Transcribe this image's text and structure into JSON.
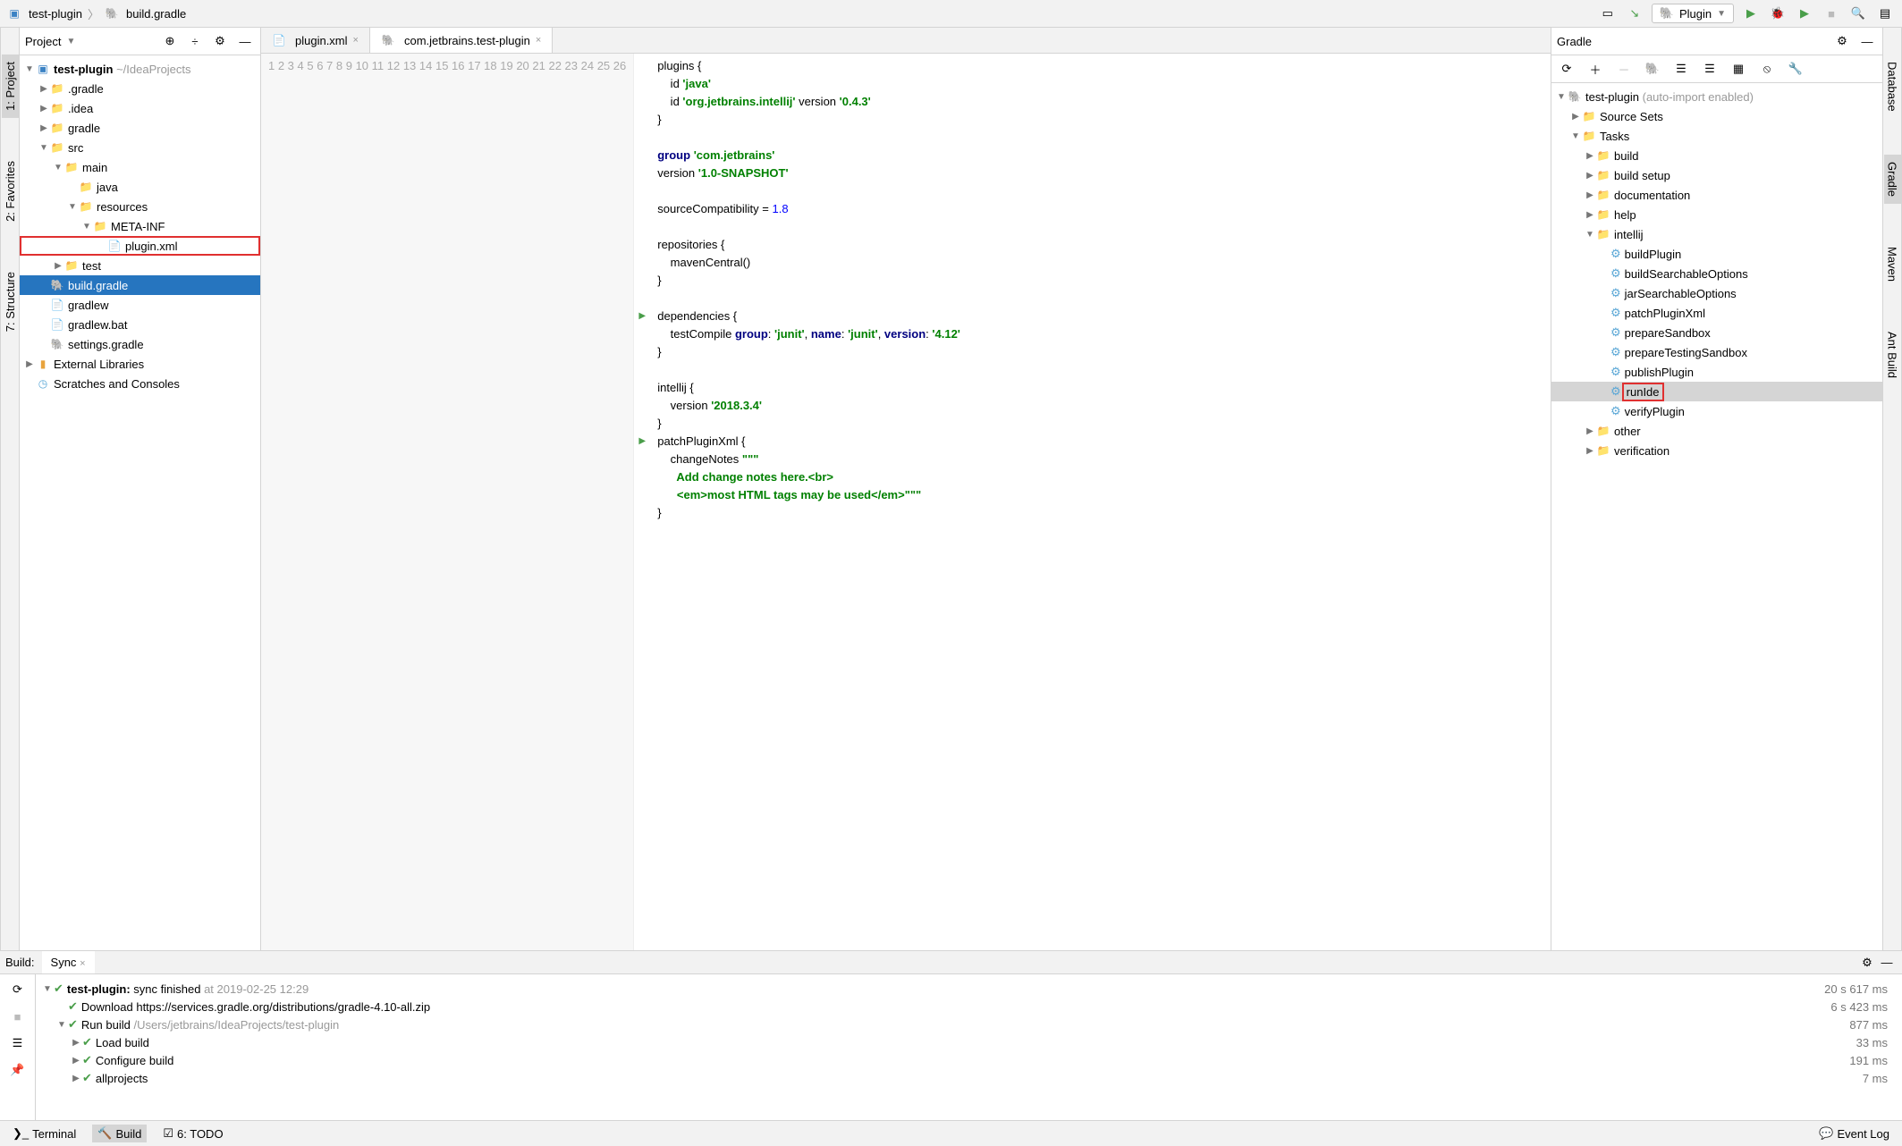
{
  "breadcrumb": {
    "project": "test-plugin",
    "file": "build.gradle"
  },
  "run_config": "Plugin",
  "project_panel": {
    "title": "Project",
    "root": "test-plugin",
    "root_path": "~/IdeaProjects",
    "items": {
      "gradle_dir": ".gradle",
      "idea_dir": ".idea",
      "gradle": "gradle",
      "src": "src",
      "main": "main",
      "java": "java",
      "resources": "resources",
      "meta_inf": "META-INF",
      "plugin_xml": "plugin.xml",
      "test": "test",
      "build_gradle": "build.gradle",
      "gradlew": "gradlew",
      "gradlew_bat": "gradlew.bat",
      "settings_gradle": "settings.gradle",
      "ext_libs": "External Libraries",
      "scratches": "Scratches and Consoles"
    }
  },
  "editor_tabs": {
    "plugin_xml": "plugin.xml",
    "main_tab": "com.jetbrains.test-plugin"
  },
  "gradle_panel": {
    "title": "Gradle",
    "root": "test-plugin",
    "root_hint": "(auto-import enabled)",
    "source_sets": "Source Sets",
    "tasks": "Tasks",
    "groups": {
      "build": "build",
      "build_setup": "build setup",
      "documentation": "documentation",
      "help": "help",
      "intellij": "intellij",
      "other": "other",
      "verification": "verification"
    },
    "intellij_tasks": {
      "buildPlugin": "buildPlugin",
      "buildSearchableOptions": "buildSearchableOptions",
      "jarSearchableOptions": "jarSearchableOptions",
      "patchPluginXml": "patchPluginXml",
      "prepareSandbox": "prepareSandbox",
      "prepareTestingSandbox": "prepareTestingSandbox",
      "publishPlugin": "publishPlugin",
      "runIde": "runIde",
      "verifyPlugin": "verifyPlugin"
    }
  },
  "bottom": {
    "build_label": "Build:",
    "sync_label": "Sync",
    "rows": {
      "sync_finished_prefix": "test-plugin:",
      "sync_finished": "sync finished",
      "sync_time": "at 2019-02-25 12:29",
      "sync_dur": "20 s 617 ms",
      "download": "Download https://services.gradle.org/distributions/gradle-4.10-all.zip",
      "download_dur": "6 s 423 ms",
      "run_build": "Run build",
      "run_build_path": "/Users/jetbrains/IdeaProjects/test-plugin",
      "run_build_dur": "877 ms",
      "load_build": "Load build",
      "load_build_dur": "33 ms",
      "configure_build": "Configure build",
      "configure_build_dur": "191 ms",
      "allprojects": "allprojects",
      "allprojects_dur": "7 ms"
    }
  },
  "statusbar": {
    "terminal": "Terminal",
    "build": "Build",
    "todo": "6: TODO",
    "event_log": "Event Log"
  },
  "right_gutter": {
    "database": "Database",
    "gradle": "Gradle",
    "maven": "Maven",
    "ant": "Ant Build"
  },
  "left_gutter": {
    "project": "1: Project",
    "favorites": "2: Favorites",
    "structure": "7: Structure"
  },
  "code_lines": [
    "plugins {",
    "    id 'java'",
    "    id 'org.jetbrains.intellij' version '0.4.3'",
    "}",
    "",
    "group 'com.jetbrains'",
    "version '1.0-SNAPSHOT'",
    "",
    "sourceCompatibility = 1.8",
    "",
    "repositories {",
    "    mavenCentral()",
    "}",
    "",
    "dependencies {",
    "    testCompile group: 'junit', name: 'junit', version: '4.12'",
    "}",
    "",
    "intellij {",
    "    version '2018.3.4'",
    "}",
    "patchPluginXml {",
    "    changeNotes \"\"\"",
    "      Add change notes here.<br>",
    "      <em>most HTML tags may be used</em>\"\"\"",
    "}"
  ]
}
